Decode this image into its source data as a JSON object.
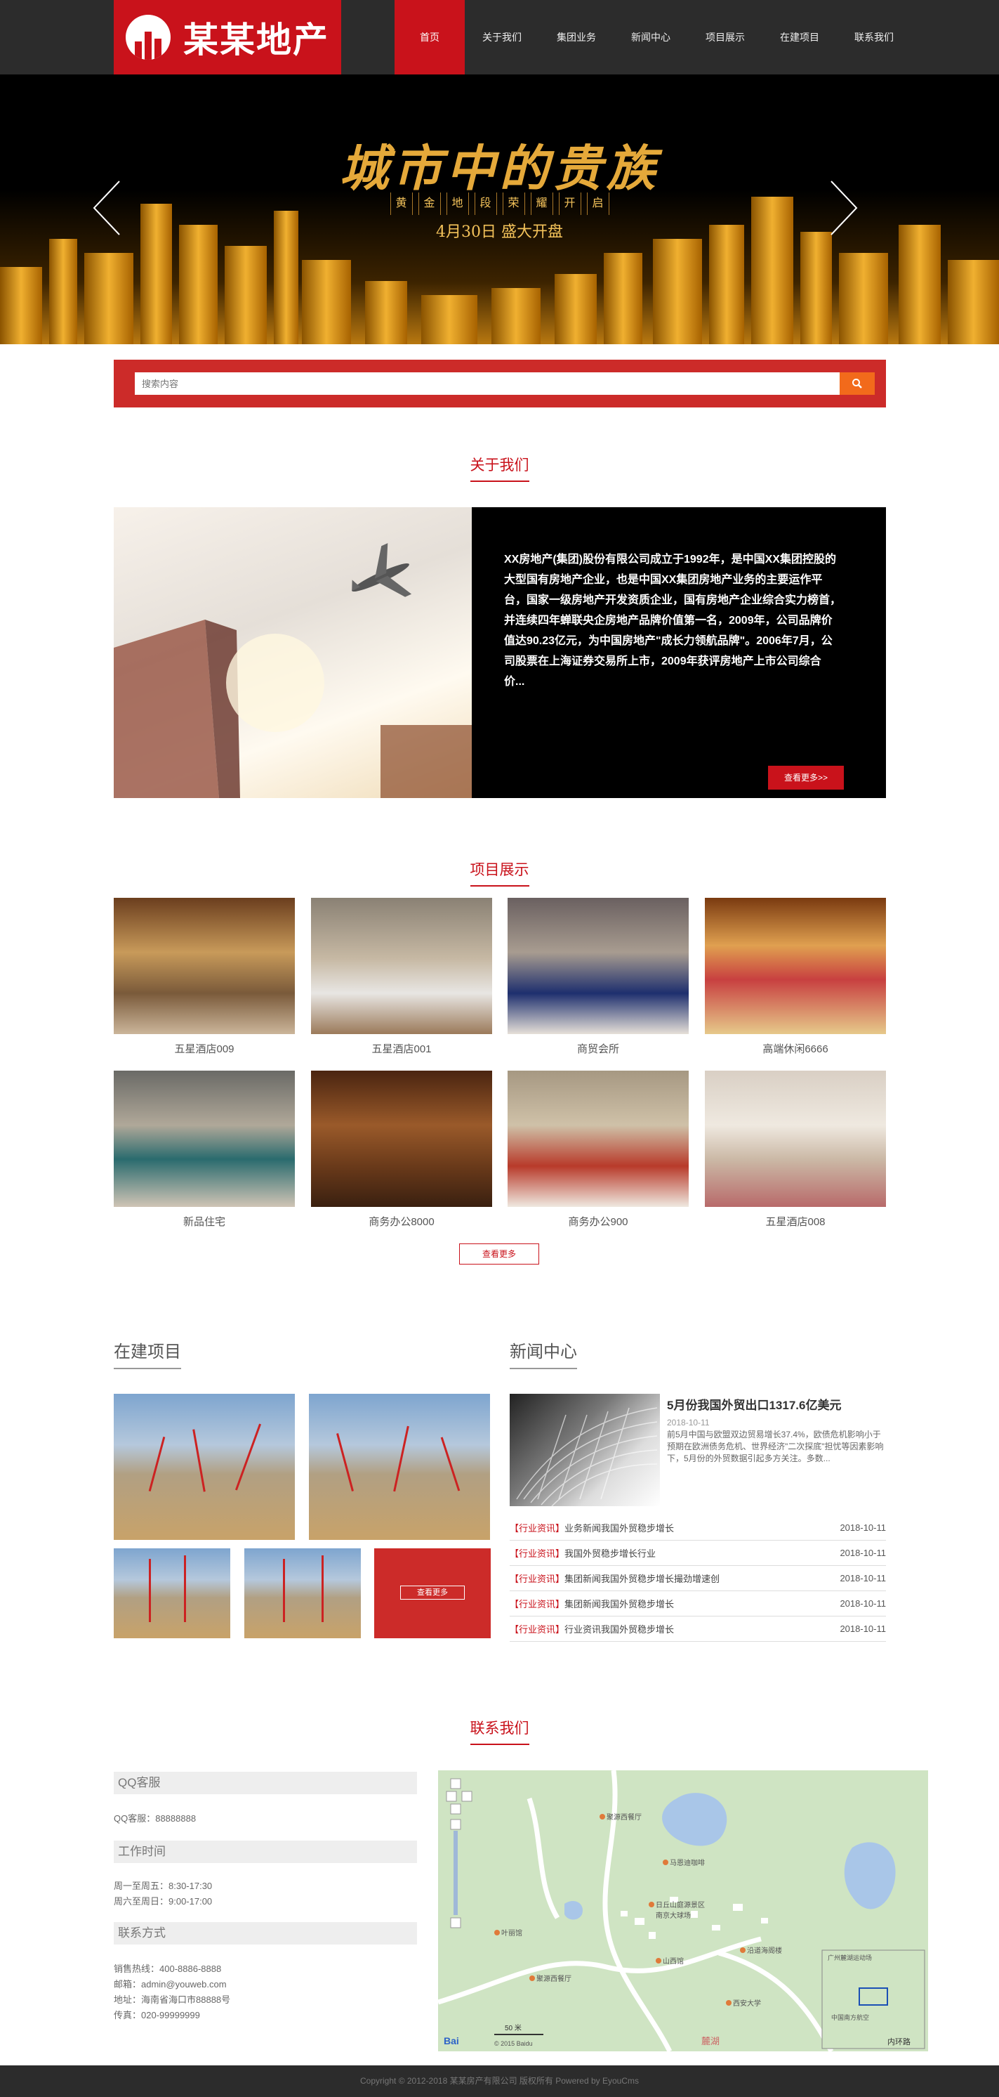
{
  "header": {
    "logo_text": "某某地产",
    "nav": [
      "首页",
      "关于我们",
      "集团业务",
      "新闻中心",
      "项目展示",
      "在建项目",
      "联系我们"
    ]
  },
  "banner": {
    "title": "城市中的贵族",
    "subtitle_chars": [
      "黄",
      "金",
      "地",
      "段",
      "荣",
      "耀",
      "开",
      "启"
    ],
    "date_line": "4月30日 盛大开盘"
  },
  "search": {
    "placeholder": "搜索内容"
  },
  "about": {
    "section_title": "关于我们",
    "text": "XX房地产(集团)股份有限公司成立于1992年，是中国XX集团控股的大型国有房地产企业，也是中国XX集团房地产业务的主要运作平台，国家一级房地产开发资质企业，国有房地产企业综合实力榜首，并连续四年蝉联央企房地产品牌价值第一名，2009年，公司品牌价值达90.23亿元，为中国房地产\"成长力领航品牌\"。2006年7月，公司股票在上海证券交易所上市，2009年获评房地产上市公司综合价...",
    "more_label": "查看更多>>"
  },
  "projects": {
    "section_title": "项目展示",
    "items": [
      "五星酒店009",
      "五星酒店001",
      "商贸会所",
      "高端休闲6666",
      "新品住宅",
      "商务办公8000",
      "商务办公900",
      "五星酒店008"
    ],
    "more_label": "查看更多"
  },
  "construction": {
    "title": "在建项目",
    "more_label": "查看更多"
  },
  "news": {
    "title": "新闻中心",
    "featured": {
      "headline": "5月份我国外贸出口1317.6亿美元",
      "date": "2018-10-11",
      "summary": "前5月中国与欧盟双边贸易增长37.4%，欧债危机影响小于预期在欧洲债务危机、世界经济\"二次探底\"担忧等因素影响下，5月份的外贸数据引起多方关注。多数..."
    },
    "items": [
      {
        "tag": "【行业资讯】",
        "title": "业务新闻我国外贸稳步增长",
        "date": "2018-10-11"
      },
      {
        "tag": "【行业资讯】",
        "title": "我国外贸稳步增长行业",
        "date": "2018-10-11"
      },
      {
        "tag": "【行业资讯】",
        "title": "集团新闻我国外贸稳步增长撮劲增速创",
        "date": "2018-10-11"
      },
      {
        "tag": "【行业资讯】",
        "title": "集团新闻我国外贸稳步增长",
        "date": "2018-10-11"
      },
      {
        "tag": "【行业资讯】",
        "title": "行业资讯我国外贸稳步增长",
        "date": "2018-10-11"
      }
    ]
  },
  "contact": {
    "section_title": "联系我们",
    "qq_head": "QQ客服",
    "qq_line": "QQ客服：88888888",
    "hours_head": "工作时间",
    "hours_1": "周一至周五：8:30-17:30",
    "hours_2": "周六至周日：9:00-17:00",
    "contact_head": "联系方式",
    "phone": "销售热线：400-8886-8888",
    "email": "邮箱：admin@youweb.com",
    "address": "地址：海南省海口市88888号",
    "fax": "传真：020-99999999",
    "map_labels": [
      "聚源西餐厅",
      "马恩迪咖啡",
      "日丘山庭源景区",
      "南京大球场",
      "叶丽馆",
      "聚源西餐厅",
      "山西馆",
      "沿道海阁楼",
      "西安大学",
      "麓湖",
      "内环路",
      "广州麓湖运动场",
      "中国南方航空"
    ],
    "map_scale": "50 米",
    "map_copyright": "© 2015 Baidu"
  },
  "footer": {
    "text": "Copyright © 2012-2018 某某房产有限公司 版权所有 Powered by EyouCms"
  },
  "colors": {
    "brand_red": "#c9121b",
    "dark_bar": "#2c2c2c",
    "search_orange": "#f26a1b"
  }
}
